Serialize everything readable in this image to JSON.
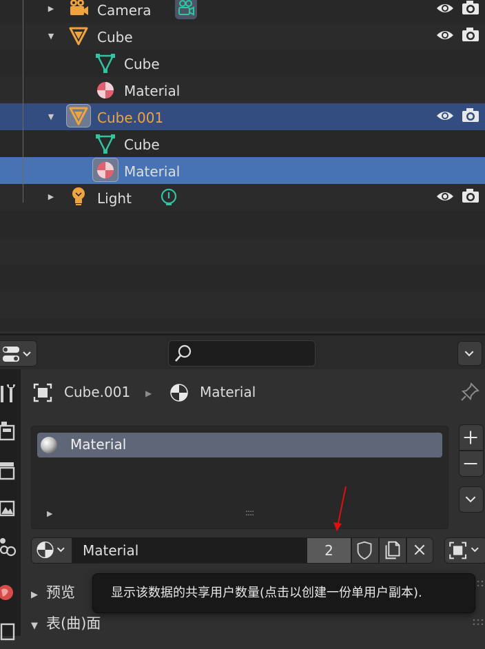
{
  "outliner": {
    "rows": [
      {
        "label": "Camera",
        "data_label": ""
      },
      {
        "label": "Cube"
      },
      {
        "label": "Cube"
      },
      {
        "label": "Material"
      },
      {
        "label": "Cube.001"
      },
      {
        "label": "Cube"
      },
      {
        "label": "Material"
      },
      {
        "label": "Light"
      }
    ]
  },
  "properties": {
    "search": {
      "value": "",
      "placeholder": ""
    },
    "breadcrumb": {
      "object": "Cube.001",
      "material": "Material"
    },
    "material_slots": [
      {
        "label": "Material"
      }
    ],
    "list_handle": "::::",
    "material_datablock": {
      "name": "Material",
      "user_count": "2"
    },
    "panels": [
      {
        "label": "预览",
        "expanded": false
      },
      {
        "label": "表(曲)面",
        "expanded": true
      }
    ],
    "tooltip": "显示该数据的共享用户数量(点击以创建一份单用户副本)."
  },
  "colors": {
    "active_row": "#4772b3",
    "highlight_row": "#334d80",
    "active_object_text": "#f0a440",
    "mesh_data_icon": "#2fc5a0",
    "object_icon": "#f0a440",
    "material_icon": "#e06070",
    "annotation_arrow": "#e01010"
  }
}
